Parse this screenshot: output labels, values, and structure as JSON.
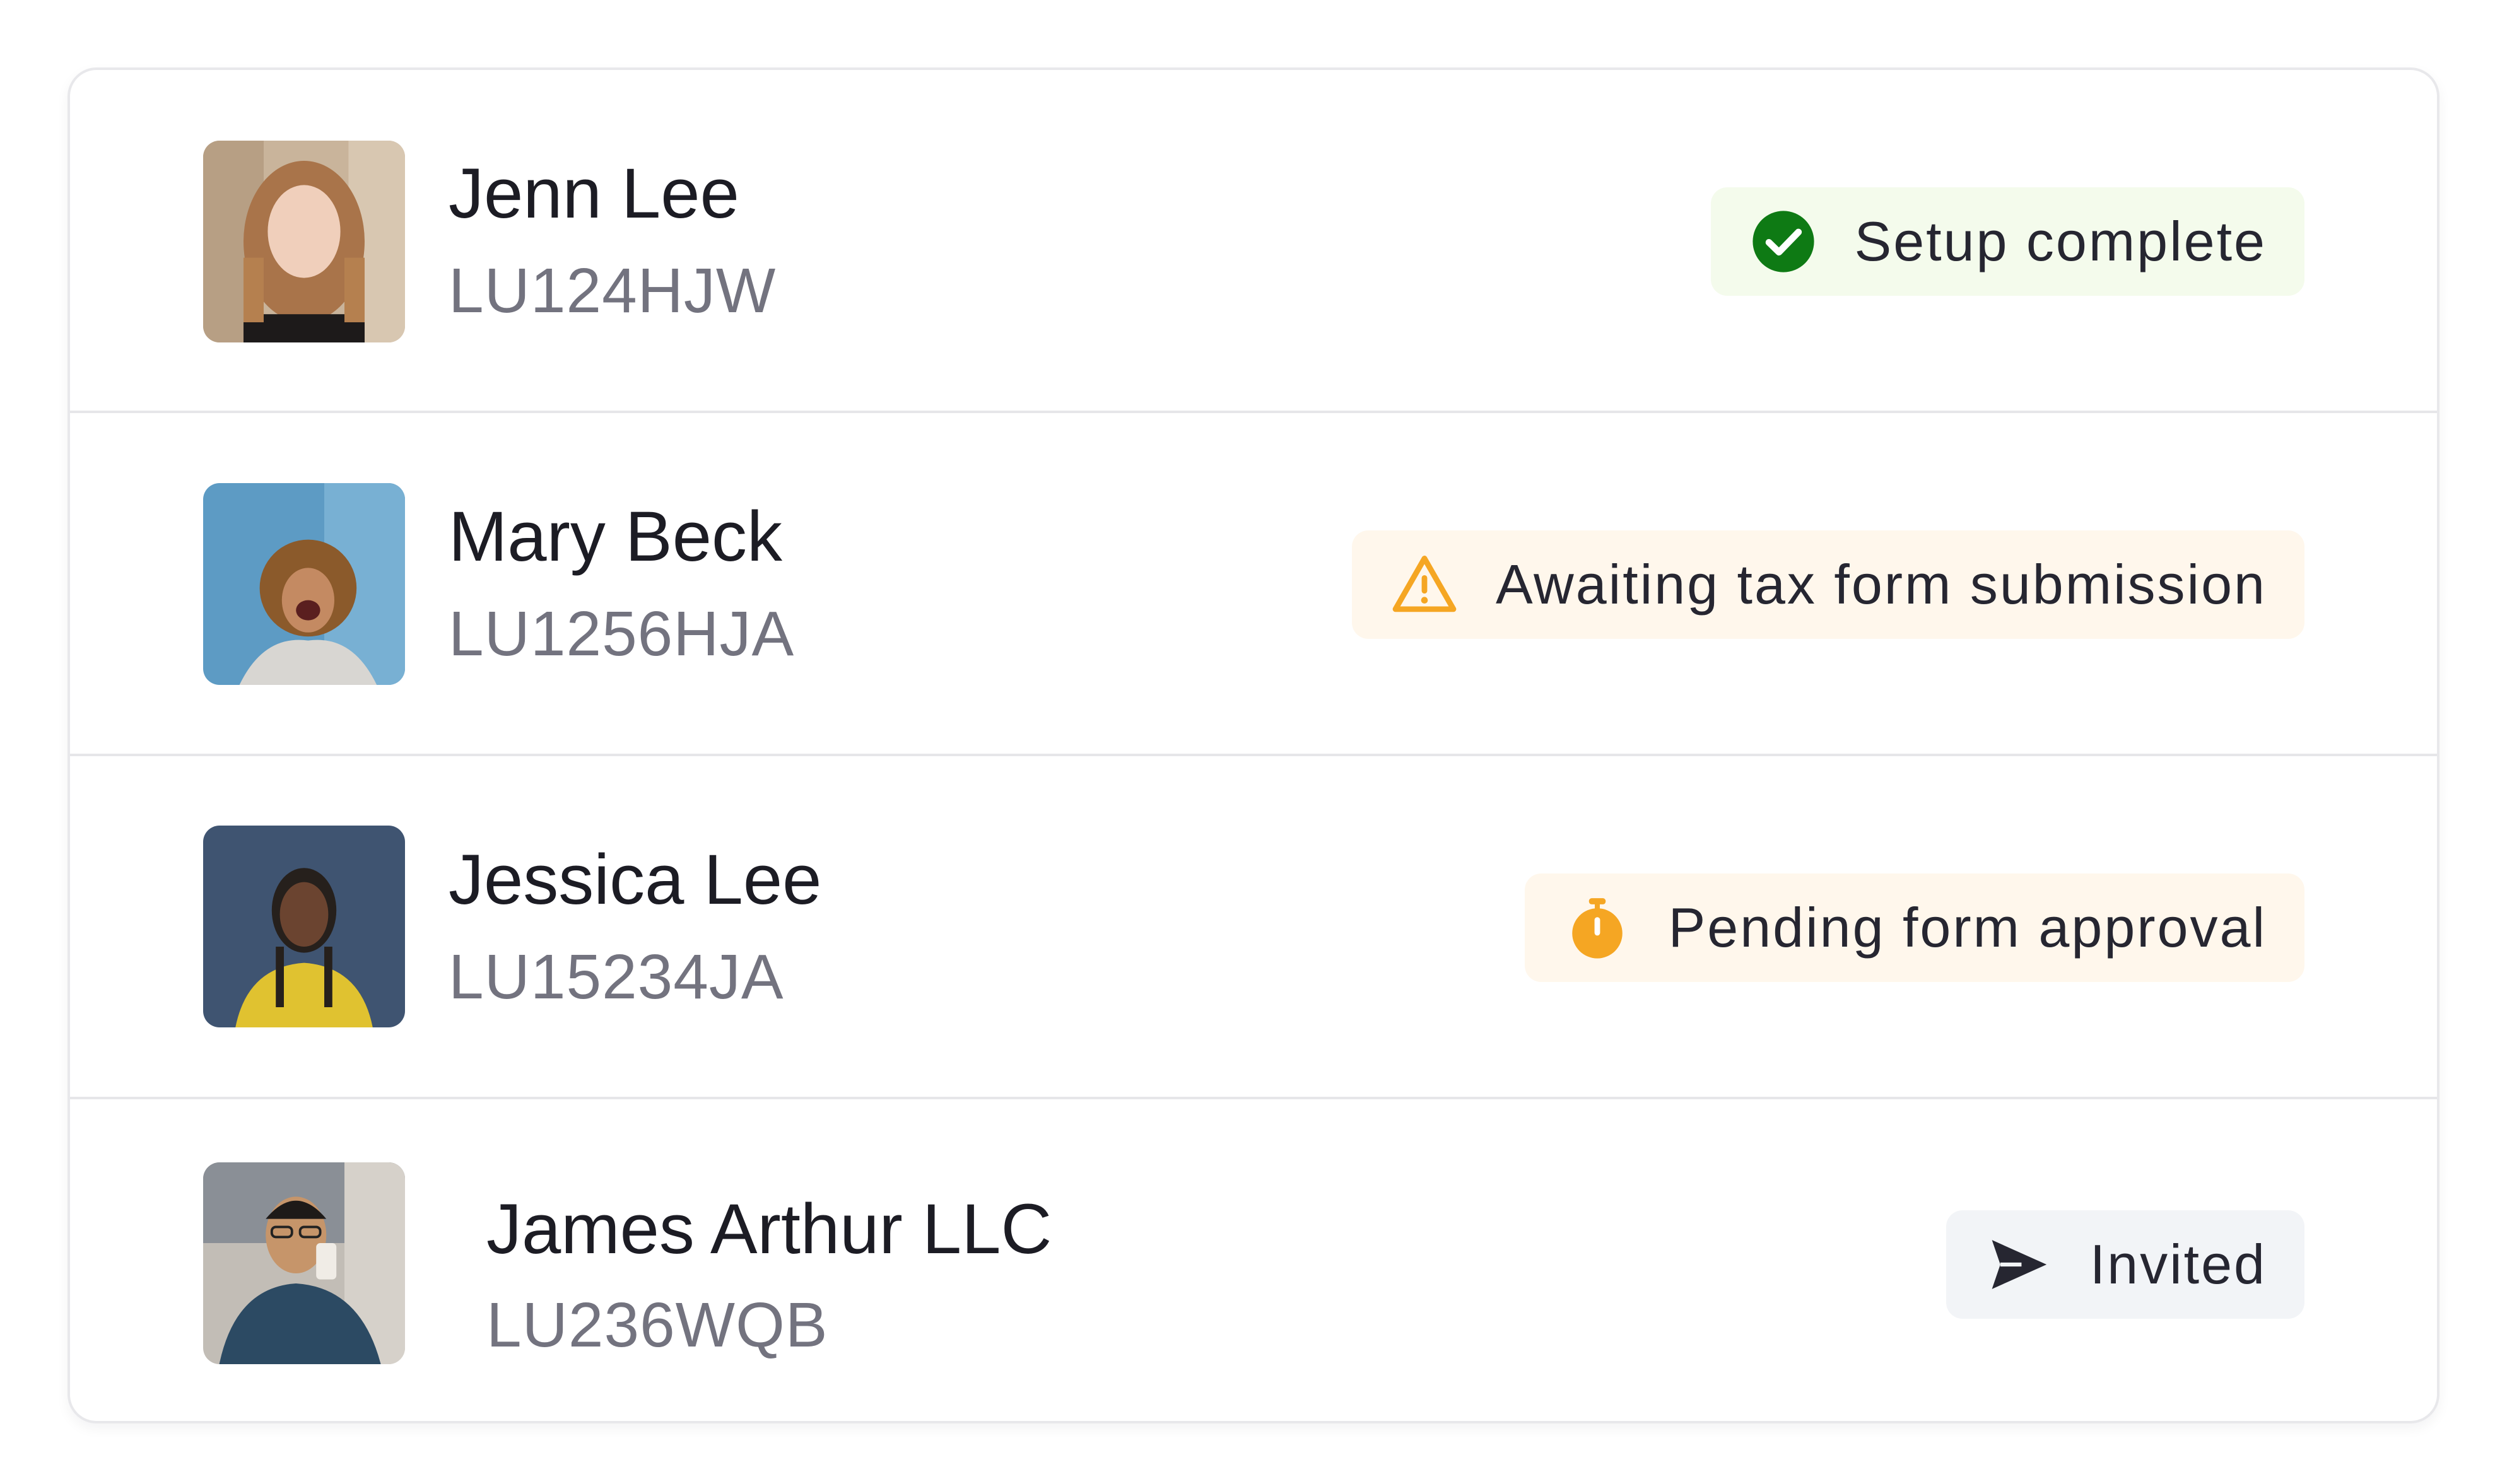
{
  "contacts": [
    {
      "name": "Jenn Lee",
      "code": "LU124HJW",
      "status": {
        "label": "Setup complete",
        "icon": "check-circle-icon",
        "color": "#0e7a14",
        "background": "#f4fbec"
      }
    },
    {
      "name": "Mary Beck",
      "code": "LU1256HJA",
      "status": {
        "label": "Awaiting tax form submission",
        "icon": "warning-triangle-icon",
        "color": "#f5a623",
        "background": "#fff7ec"
      }
    },
    {
      "name": "Jessica Lee",
      "code": "LU15234JA",
      "status": {
        "label": "Pending form approval",
        "icon": "stopwatch-icon",
        "color": "#f5a623",
        "background": "#fff7ec"
      }
    },
    {
      "name": "James Arthur LLC",
      "code": "LU236WQB",
      "status": {
        "label": "Invited",
        "icon": "send-icon",
        "color": "#262631",
        "background": "#f2f4f7"
      }
    }
  ]
}
